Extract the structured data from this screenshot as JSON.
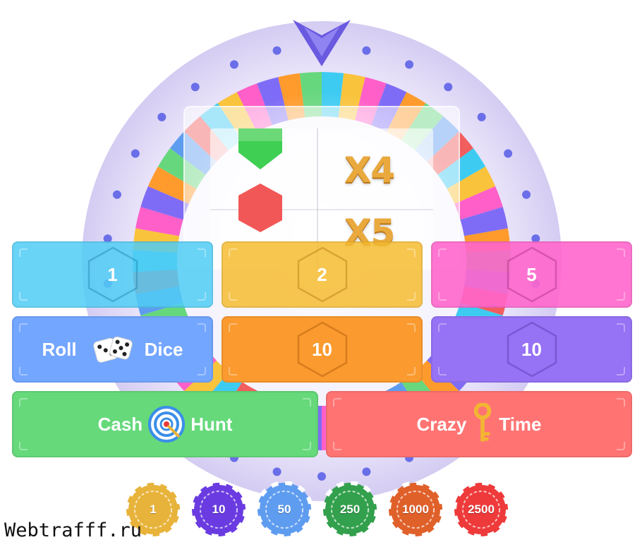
{
  "colors": {
    "wheel_ring": "#ded8f6",
    "pointer": "#6a5ae0",
    "tile_1": "#50cdf5",
    "tile_2": "#f6bc30",
    "tile_5": "#ff66cc",
    "tile_roll": "#73a6ff",
    "tile_10a": "#fb9a2e",
    "tile_10b": "#9672f5",
    "tile_cash": "#66d97b",
    "tile_crazy": "#ff7473"
  },
  "result": {
    "multipliers": [
      "X4",
      "X5"
    ],
    "pieces": [
      "green-hexagon-icon",
      "red-hexagon-icon"
    ]
  },
  "bets": {
    "row1": [
      {
        "label": "1",
        "icon": "hexagon-icon"
      },
      {
        "label": "2",
        "icon": "hexagon-icon"
      },
      {
        "label": "5",
        "icon": "hexagon-icon"
      }
    ],
    "row2": [
      {
        "left": "Roll",
        "right": "Dice",
        "icon": "dice-icon"
      },
      {
        "label": "10",
        "icon": "hexagon-icon"
      },
      {
        "label": "10",
        "icon": "hexagon-icon"
      }
    ],
    "row3": [
      {
        "left": "Cash",
        "right": "Hunt",
        "icon": "target-icon"
      },
      {
        "left": "Crazy",
        "right": "Time",
        "icon": "key-icon"
      }
    ]
  },
  "chips": [
    {
      "label": "1",
      "color": "#e8b33a"
    },
    {
      "label": "10",
      "color": "#6a3be0"
    },
    {
      "label": "50",
      "color": "#5e9cf0"
    },
    {
      "label": "250",
      "color": "#32a04c"
    },
    {
      "label": "1000",
      "color": "#e0602a"
    },
    {
      "label": "2500",
      "color": "#ee3a3a"
    }
  ],
  "watermark": "Webtrafff.ru"
}
